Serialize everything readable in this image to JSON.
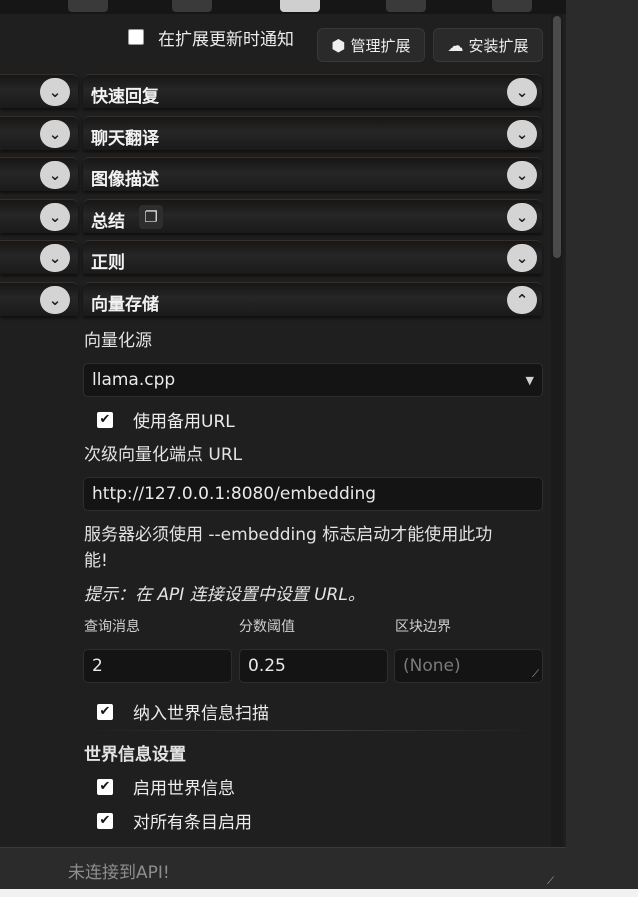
{
  "extensions_header": {
    "notify_label": "在扩展更新时通知",
    "notify_checked": false,
    "manage_button": "管理扩展",
    "manage_icon": "cubes-icon",
    "install_button": "安装扩展",
    "install_icon": "cloud-download-icon"
  },
  "drawers": [
    {
      "title": "快速回复",
      "expanded": false
    },
    {
      "title": "聊天翻译",
      "expanded": false
    },
    {
      "title": "图像描述",
      "expanded": false
    },
    {
      "title": "总结",
      "expanded": false,
      "icon": "copy-icon"
    },
    {
      "title": "正则",
      "expanded": false
    },
    {
      "title": "向量存储",
      "expanded": true
    }
  ],
  "vector_storage": {
    "source_label": "向量化源",
    "source_value": "llama.cpp",
    "use_alt_url_label": "使用备用URL",
    "use_alt_url_checked": true,
    "secondary_endpoint_label": "次级向量化端点 URL",
    "secondary_endpoint_value": "http://127.0.0.1:8080/embedding",
    "server_note_line1": "服务器必须使用 --embedding 标志启动才能使用此功",
    "server_note_line2": "能!",
    "hint": "提示：在 API 连接设置中设置 URL。",
    "query_messages_label": "查询消息",
    "query_messages_value": "2",
    "score_threshold_label": "分数阈值",
    "score_threshold_value": "0.25",
    "chunk_boundary_label": "区块边界",
    "chunk_boundary_placeholder": "(None)",
    "include_wi_label": "纳入世界信息扫描",
    "include_wi_checked": true,
    "wi_settings_title": "世界信息设置",
    "enable_wi_label": "启用世界信息",
    "enable_wi_checked": true,
    "enable_all_label": "对所有条目启用",
    "enable_all_checked": true
  },
  "status_bar": {
    "text": "未连接到API!"
  }
}
